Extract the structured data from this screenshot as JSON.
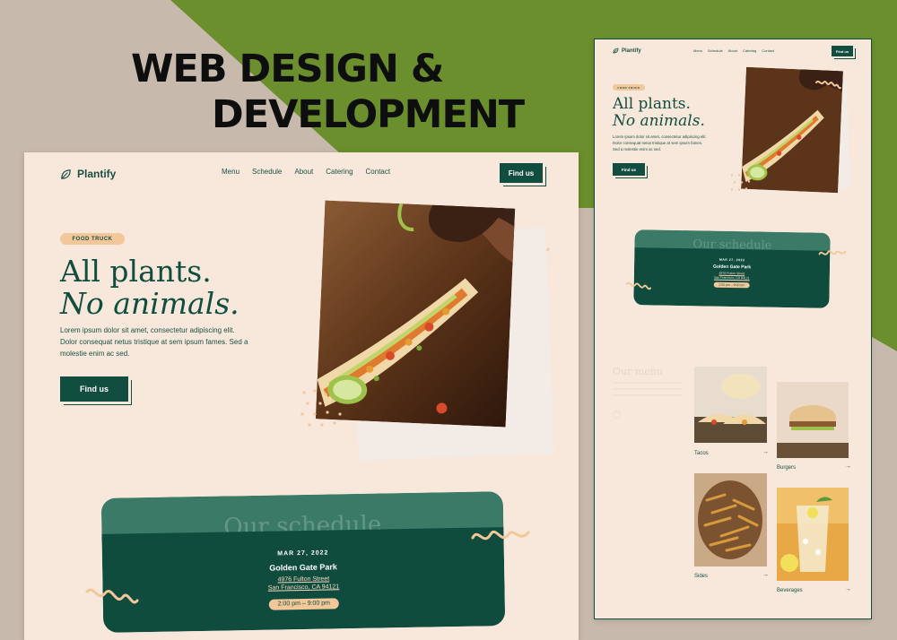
{
  "headline": {
    "line1": "WEB DESIGN &",
    "line2": "DEVELOPMENT"
  },
  "colors": {
    "brand_green": "#114e3f",
    "olive": "#6b8f2c",
    "cream": "#f8e8dc",
    "peach": "#f2c79a",
    "taupe": "#c8b9ad"
  },
  "site": {
    "logo_icon": "leaf-icon",
    "logo_text": "Plantify",
    "nav": [
      "Menu",
      "Schedule",
      "About",
      "Catering",
      "Contact"
    ],
    "nav_button": "Find us",
    "badge": "FOOD TRUCK",
    "title_line1": "All plants.",
    "title_line2": "No animals.",
    "lead": "Lorem ipsum dolor sit amet, consectetur adipiscing elit. Dolor consequat netus tristique at sem ipsum fames. Sed a molestie enim ac sed.",
    "cta": "Find us",
    "hero_image": "tacos-photo",
    "schedule": {
      "ghost_title": "Our schedule",
      "date": "MAR 27, 2022",
      "place": "Golden Gate Park",
      "address1": "4976 Fulton Street",
      "address2": "San Francisco, CA 94121",
      "time": "2:00 pm – 9:00 pm"
    },
    "menu": {
      "title": "Our menu",
      "items": [
        {
          "label": "Tacos",
          "icon": "arrow-right-icon"
        },
        {
          "label": "Burgers",
          "icon": "arrow-right-icon"
        },
        {
          "label": "Sides",
          "icon": "arrow-right-icon"
        },
        {
          "label": "Beverages",
          "icon": "arrow-right-icon"
        }
      ]
    }
  }
}
